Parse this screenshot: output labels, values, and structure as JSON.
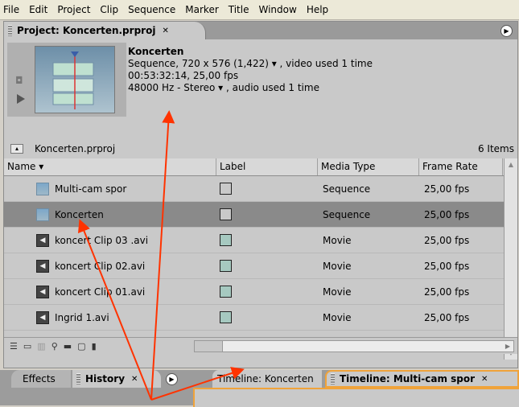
{
  "menubar": {
    "items": [
      "File",
      "Edit",
      "Project",
      "Clip",
      "Sequence",
      "Marker",
      "Title",
      "Window",
      "Help"
    ]
  },
  "project_panel": {
    "tab_label": "Project: Koncerten.prproj",
    "close": "✕",
    "clip_name": "Koncerten",
    "info_line1": "Sequence, 720 x 576 (1,422) ▾ , video used 1 time",
    "info_line2": "00:53:32:14, 25,00 fps",
    "info_line3": "48000 Hz - Stereo ▾ , audio used 1 time",
    "path": "Koncerten.prproj",
    "item_count": "6 Items"
  },
  "columns": [
    "Name ▾",
    "Label",
    "Media Type",
    "Frame Rate"
  ],
  "rows": [
    {
      "name": "Multi-cam spor",
      "type": "Sequence",
      "rate": "25,00 fps",
      "icon": "sequence-icon"
    },
    {
      "name": "Koncerten",
      "type": "Sequence",
      "rate": "25,00 fps",
      "icon": "sequence-icon"
    },
    {
      "name": "koncert Clip 03 .avi",
      "type": "Movie",
      "rate": "25,00 fps",
      "icon": "movie-icon"
    },
    {
      "name": "koncert Clip 02.avi",
      "type": "Movie",
      "rate": "25,00 fps",
      "icon": "movie-icon"
    },
    {
      "name": "koncert Clip 01.avi",
      "type": "Movie",
      "rate": "25,00 fps",
      "icon": "movie-icon"
    },
    {
      "name": "Ingrid 1.avi",
      "type": "Movie",
      "rate": "25,00 fps",
      "icon": "movie-icon"
    }
  ],
  "bottom_tabs": {
    "effects": "Effects",
    "history": "History",
    "history_close": "✕",
    "timeline1": "Timeline: Koncerten",
    "timeline2": "Timeline: Multi-cam spor",
    "timeline2_close": "✕"
  },
  "colors": {
    "accent_orange": "#f0a33a",
    "arrow_red": "#ff3300",
    "selected_row": "#8a8a8a"
  }
}
